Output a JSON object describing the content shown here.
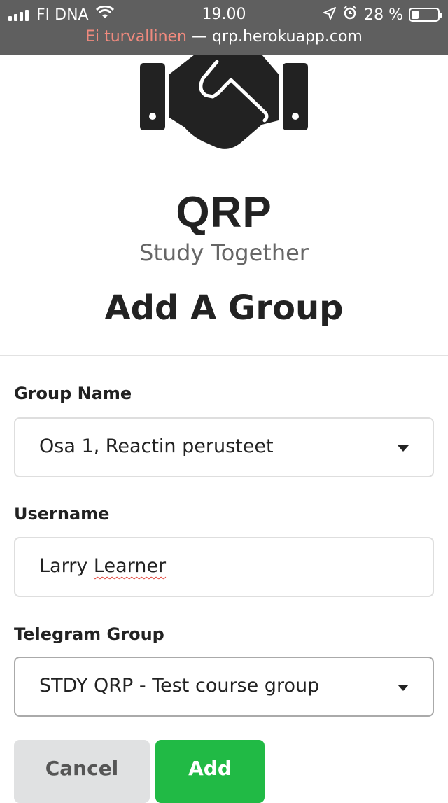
{
  "status": {
    "carrier": "FI DNA",
    "time": "19.00",
    "battery": "28 %",
    "battery_level": 0.28,
    "icons": [
      "signal-icon",
      "wifi-icon",
      "location-arrow-icon",
      "alarm-icon",
      "battery-icon"
    ]
  },
  "browser": {
    "security_text": "Ei turvallinen",
    "separator": " — ",
    "domain": "qrp.herokuapp.com"
  },
  "header": {
    "logo_icon": "handshake-icon",
    "brand": "QRP",
    "tagline": "Study Together",
    "title": "Add A Group"
  },
  "form": {
    "group_name": {
      "label": "Group Name",
      "value": "Osa 1, Reactin perusteet"
    },
    "username": {
      "label": "Username",
      "value_first": "Larry ",
      "value_misspelled": "Learner"
    },
    "telegram_group": {
      "label": "Telegram Group",
      "value": "STDY QRP - Test course group"
    }
  },
  "actions": {
    "cancel": "Cancel",
    "add": "Add"
  },
  "colors": {
    "status_bg": "#5f5f5f",
    "insecure": "#f08a7e",
    "add_button": "#21ba45",
    "cancel_button": "#e0e1e2",
    "text": "#222222"
  }
}
